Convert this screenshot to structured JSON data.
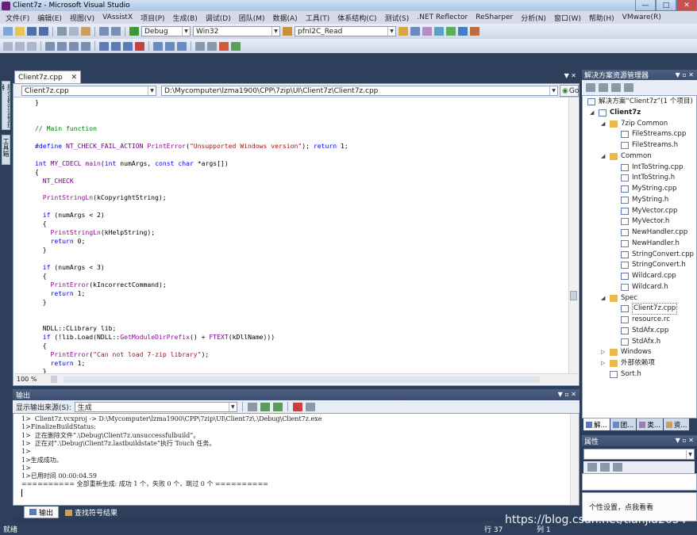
{
  "window": {
    "title": "Client7z - Microsoft Visual Studio"
  },
  "menu": [
    "文件(F)",
    "编辑(E)",
    "视图(V)",
    "VAssistX",
    "项目(P)",
    "生成(B)",
    "调试(D)",
    "团队(M)",
    "数据(A)",
    "工具(T)",
    "体系结构(C)",
    "测试(S)",
    ".NET Reflector",
    "ReSharper",
    "分析(N)",
    "窗口(W)",
    "帮助(H)",
    "VMware(R)"
  ],
  "toolbar": {
    "config": "Debug",
    "platform": "Win32",
    "find": "pfnI2C_Read"
  },
  "left_tabs": [
    "服务器资源管理器",
    "工具箱"
  ],
  "editor": {
    "tab_label": "Client7z.cpp",
    "scope_combo": "Client7z.cpp",
    "path_combo": "D:\\Mycomputer\\lzma1900\\CPP\\7zip\\UI\\Client7z\\Client7z.cpp",
    "go_label": "Go",
    "zoom": "100 %",
    "lines": [
      [
        [
          "pl",
          "}"
        ]
      ],
      [],
      [],
      [
        [
          "cm",
          "// Main function"
        ]
      ],
      [],
      [
        [
          "kw",
          "#define "
        ],
        [
          "mc",
          "NT_CHECK_FAIL_ACTION "
        ],
        [
          "fn",
          "PrintError"
        ],
        [
          "pl",
          "("
        ],
        [
          "st",
          "\"Unsupported Windows version\""
        ],
        [
          "pl",
          "); "
        ],
        [
          "kw",
          "return "
        ],
        [
          "pl",
          "1;"
        ]
      ],
      [],
      [
        [
          "kw",
          "int "
        ],
        [
          "mc",
          "MY_CDECL "
        ],
        [
          "fn",
          "main"
        ],
        [
          "pl",
          "("
        ],
        [
          "kw",
          "int "
        ],
        [
          "pl",
          "numArgs, "
        ],
        [
          "kw",
          "const char "
        ],
        [
          "pl",
          "*args[])"
        ]
      ],
      [
        [
          "pl",
          "{"
        ]
      ],
      [
        [
          "mc",
          "  NT_CHECK"
        ]
      ],
      [],
      [
        [
          "fn",
          "  PrintStringLn"
        ],
        [
          "pl",
          "(kCopyrightString);"
        ]
      ],
      [],
      [
        [
          "kw",
          "  if "
        ],
        [
          "pl",
          "(numArgs < 2)"
        ]
      ],
      [
        [
          "pl",
          "  {"
        ]
      ],
      [
        [
          "fn",
          "    PrintStringLn"
        ],
        [
          "pl",
          "(kHelpString);"
        ]
      ],
      [
        [
          "kw",
          "    return "
        ],
        [
          "pl",
          "0;"
        ]
      ],
      [
        [
          "pl",
          "  }"
        ]
      ],
      [],
      [
        [
          "kw",
          "  if "
        ],
        [
          "pl",
          "(numArgs < 3)"
        ]
      ],
      [
        [
          "pl",
          "  {"
        ]
      ],
      [
        [
          "fn",
          "    PrintError"
        ],
        [
          "pl",
          "(kIncorrectCommand);"
        ]
      ],
      [
        [
          "kw",
          "    return "
        ],
        [
          "pl",
          "1;"
        ]
      ],
      [
        [
          "pl",
          "  }"
        ]
      ],
      [],
      [],
      [
        [
          "pl",
          "  NDLL::CLibrary lib;"
        ]
      ],
      [
        [
          "kw",
          "  if "
        ],
        [
          "pl",
          "(!lib.Load("
        ],
        [
          "pl",
          "NDLL::"
        ],
        [
          "fn",
          "GetModuleDirPrefix"
        ],
        [
          "pl",
          "() + "
        ],
        [
          "mc",
          "FTEXT"
        ],
        [
          "pl",
          "(kDllName)))"
        ]
      ],
      [
        [
          "pl",
          "  {"
        ]
      ],
      [
        [
          "fn",
          "    PrintError"
        ],
        [
          "pl",
          "("
        ],
        [
          "st",
          "\"Can not load 7-zip library\""
        ],
        [
          "pl",
          ");"
        ]
      ],
      [
        [
          "kw",
          "    return "
        ],
        [
          "pl",
          "1;"
        ]
      ],
      [
        [
          "pl",
          "  }"
        ]
      ]
    ]
  },
  "output": {
    "title": "输出",
    "source_label": "显示输出来源(S):",
    "source_value": "生成",
    "lines": [
      "1>  Client7z.vcxproj -> D:\\Mycomputer\\lzma1900\\CPP\\7zip\\UI\\Client7z\\.\\Debug\\Client7z.exe",
      "1>FinalizeBuildStatus:",
      "1>  正在删除文件“.\\Debug\\Client7z.unsuccessfulbuild”。",
      "1>  正在对“.\\Debug\\Client7z.lastbuildstate”执行 Touch 任务。",
      "1>",
      "1>生成成功。",
      "1>",
      "1>已用时间 00:00:04.59",
      "========== 全部重新生成: 成功 1 个，失败 0 个，跳过 0 个 =========="
    ],
    "tabs": [
      "输出",
      "查找符号结果"
    ]
  },
  "solution": {
    "title": "解决方案资源管理器",
    "items": [
      {
        "label": "解决方案“Client7z”(1 个项目)",
        "lvl": 0,
        "kind": "sln"
      },
      {
        "label": "Client7z",
        "lvl": 0,
        "kind": "proj",
        "exp": "◢"
      },
      {
        "label": "7zip Common",
        "lvl": 1,
        "kind": "folder",
        "exp": "◢"
      },
      {
        "label": "FileStreams.cpp",
        "lvl": 2,
        "kind": "cpp"
      },
      {
        "label": "FileStreams.h",
        "lvl": 2,
        "kind": "h"
      },
      {
        "label": "Common",
        "lvl": 1,
        "kind": "folder",
        "exp": "◢"
      },
      {
        "label": "IntToString.cpp",
        "lvl": 2,
        "kind": "cpp"
      },
      {
        "label": "IntToString.h",
        "lvl": 2,
        "kind": "h"
      },
      {
        "label": "MyString.cpp",
        "lvl": 2,
        "kind": "cpp"
      },
      {
        "label": "MyString.h",
        "lvl": 2,
        "kind": "h"
      },
      {
        "label": "MyVector.cpp",
        "lvl": 2,
        "kind": "cpp"
      },
      {
        "label": "MyVector.h",
        "lvl": 2,
        "kind": "h"
      },
      {
        "label": "NewHandler.cpp",
        "lvl": 2,
        "kind": "cpp"
      },
      {
        "label": "NewHandler.h",
        "lvl": 2,
        "kind": "h"
      },
      {
        "label": "StringConvert.cpp",
        "lvl": 2,
        "kind": "cpp"
      },
      {
        "label": "StringConvert.h",
        "lvl": 2,
        "kind": "h"
      },
      {
        "label": "Wildcard.cpp",
        "lvl": 2,
        "kind": "cpp"
      },
      {
        "label": "Wildcard.h",
        "lvl": 2,
        "kind": "h"
      },
      {
        "label": "Spec",
        "lvl": 1,
        "kind": "folder",
        "exp": "◢"
      },
      {
        "label": "Client7z.cpp",
        "lvl": 2,
        "kind": "cpp"
      },
      {
        "label": "resource.rc",
        "lvl": 2,
        "kind": "h"
      },
      {
        "label": "StdAfx.cpp",
        "lvl": 2,
        "kind": "cpp"
      },
      {
        "label": "StdAfx.h",
        "lvl": 2,
        "kind": "h"
      },
      {
        "label": "Windows",
        "lvl": 1,
        "kind": "folder",
        "exp": "▷"
      },
      {
        "label": "外部依赖项",
        "lvl": 1,
        "kind": "folder",
        "exp": "▷"
      },
      {
        "label": "Sort.h",
        "lvl": 1,
        "kind": "h"
      }
    ],
    "tabs": [
      "解...",
      "团...",
      "类...",
      "资..."
    ]
  },
  "properties": {
    "title": "属性",
    "description": "个性设置，点我看看"
  },
  "status": {
    "ready": "就绪",
    "line": "行 37",
    "col": "列 1"
  },
  "watermark": "https://blog.csdn.net/tianjia2654"
}
